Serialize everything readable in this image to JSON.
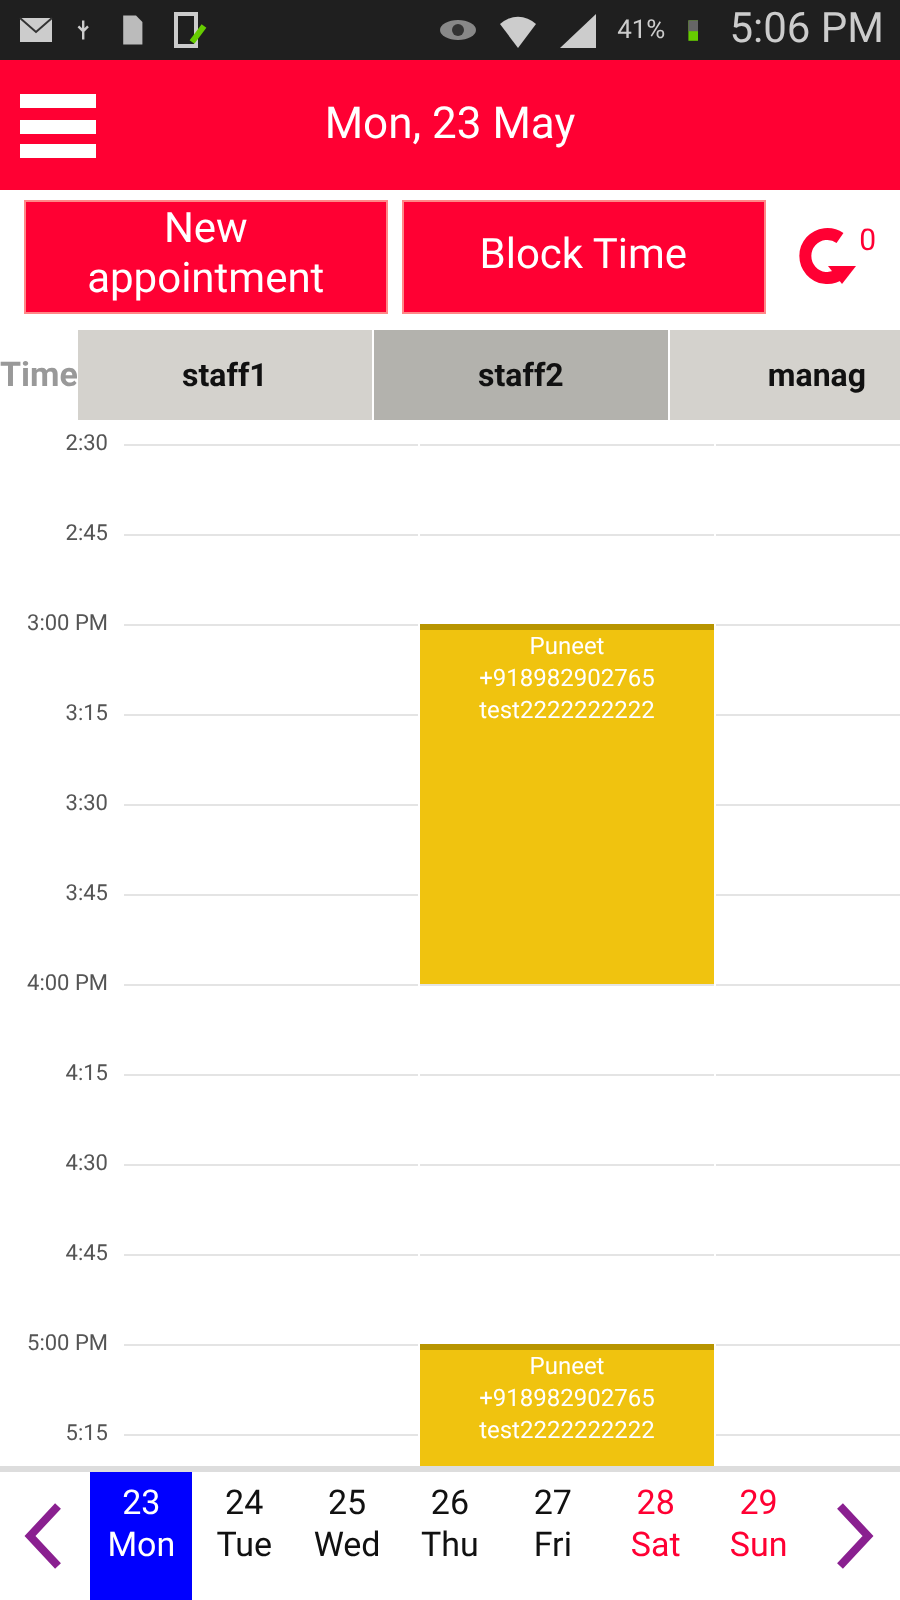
{
  "status_bar": {
    "battery": "41%",
    "time": "5:06 PM"
  },
  "header": {
    "title": "Mon, 23 May"
  },
  "actions": {
    "buttons": [
      "New appointment",
      "Block Time"
    ],
    "refresh_count": "0"
  },
  "time_header": "Time",
  "columns": [
    {
      "label": "staff1",
      "selected": false
    },
    {
      "label": "staff2",
      "selected": true
    },
    {
      "label": "manag",
      "selected": false
    }
  ],
  "slots": [
    {
      "label": "2:30",
      "cells": [
        {
          "booked": false
        },
        {
          "booked": false
        },
        {
          "booked": false
        }
      ]
    },
    {
      "label": "2:45",
      "cells": [
        {
          "booked": false
        },
        {
          "booked": false
        },
        {
          "booked": false
        }
      ]
    },
    {
      "label": "3:00 PM",
      "cells": [
        {
          "booked": false
        },
        {
          "booked": true,
          "lines": [
            "Puneet",
            "+918982902765",
            "test2222222222"
          ]
        },
        {
          "booked": false
        }
      ]
    },
    {
      "label": "3:15",
      "cells": [
        {
          "booked": false
        },
        {
          "booked": true
        },
        {
          "booked": false
        }
      ]
    },
    {
      "label": "3:30",
      "cells": [
        {
          "booked": false
        },
        {
          "booked": true
        },
        {
          "booked": false
        }
      ]
    },
    {
      "label": "3:45",
      "cells": [
        {
          "booked": false
        },
        {
          "booked": true
        },
        {
          "booked": false
        }
      ]
    },
    {
      "label": "4:00 PM",
      "cells": [
        {
          "booked": false
        },
        {
          "booked": false
        },
        {
          "booked": false
        }
      ]
    },
    {
      "label": "4:15",
      "cells": [
        {
          "booked": false
        },
        {
          "booked": false
        },
        {
          "booked": false
        }
      ]
    },
    {
      "label": "4:30",
      "cells": [
        {
          "booked": false
        },
        {
          "booked": false
        },
        {
          "booked": false
        }
      ]
    },
    {
      "label": "4:45",
      "cells": [
        {
          "booked": false
        },
        {
          "booked": false
        },
        {
          "booked": false
        }
      ]
    },
    {
      "label": "5:00 PM",
      "cells": [
        {
          "booked": false
        },
        {
          "booked": true,
          "lines": [
            "Puneet",
            "+918982902765",
            "test2222222222"
          ]
        },
        {
          "booked": false
        }
      ]
    },
    {
      "label": "5:15",
      "cells": [
        {
          "booked": false
        },
        {
          "booked": true
        },
        {
          "booked": false
        }
      ]
    }
  ],
  "days": [
    {
      "date": "23",
      "day": "Mon",
      "selected": true,
      "weekend": false
    },
    {
      "date": "24",
      "day": "Tue",
      "selected": false,
      "weekend": false
    },
    {
      "date": "25",
      "day": "Wed",
      "selected": false,
      "weekend": false
    },
    {
      "date": "26",
      "day": "Thu",
      "selected": false,
      "weekend": false
    },
    {
      "date": "27",
      "day": "Fri",
      "selected": false,
      "weekend": false
    },
    {
      "date": "28",
      "day": "Sat",
      "selected": false,
      "weekend": true
    },
    {
      "date": "29",
      "day": "Sun",
      "selected": false,
      "weekend": true
    }
  ]
}
